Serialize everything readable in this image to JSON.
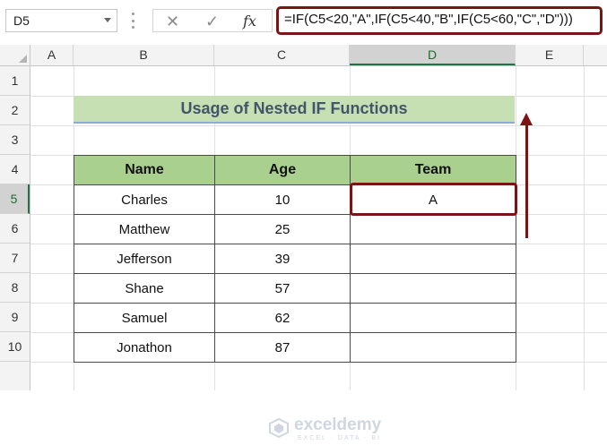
{
  "formula_bar": {
    "name_box": "D5",
    "cancel_glyph": "✕",
    "enter_glyph": "✓",
    "fx_label": "fx",
    "formula": "=IF(C5<20,\"A\",IF(C5<40,\"B\",IF(C5<60,\"C\",\"D\")))"
  },
  "grid": {
    "columns": [
      "A",
      "B",
      "C",
      "D",
      "E"
    ],
    "rows": [
      "1",
      "2",
      "3",
      "4",
      "5",
      "6",
      "7",
      "8",
      "9",
      "10"
    ],
    "selected_column": "D",
    "selected_row": "5"
  },
  "sheet": {
    "title": "Usage of Nested IF Functions",
    "headers": [
      "Name",
      "Age",
      "Team"
    ],
    "rows": [
      [
        "Charles",
        "10",
        "A"
      ],
      [
        "Matthew",
        "25",
        ""
      ],
      [
        "Jefferson",
        "39",
        ""
      ],
      [
        "Shane",
        "57",
        ""
      ],
      [
        "Samuel",
        "62",
        ""
      ],
      [
        "Jonathon",
        "87",
        ""
      ]
    ]
  },
  "watermark": {
    "name": "exceldemy",
    "tagline": "EXCEL · DATA · BI"
  },
  "colors": {
    "highlight": "#7b1515",
    "header_fill": "#a9d08e",
    "title_fill": "#c6e0b4",
    "selection": "#217346"
  },
  "icons": [
    "dropdown-arrow-icon",
    "cancel-icon",
    "enter-check-icon",
    "fx-icon",
    "select-all-icon",
    "exceldemy-logo-icon"
  ]
}
